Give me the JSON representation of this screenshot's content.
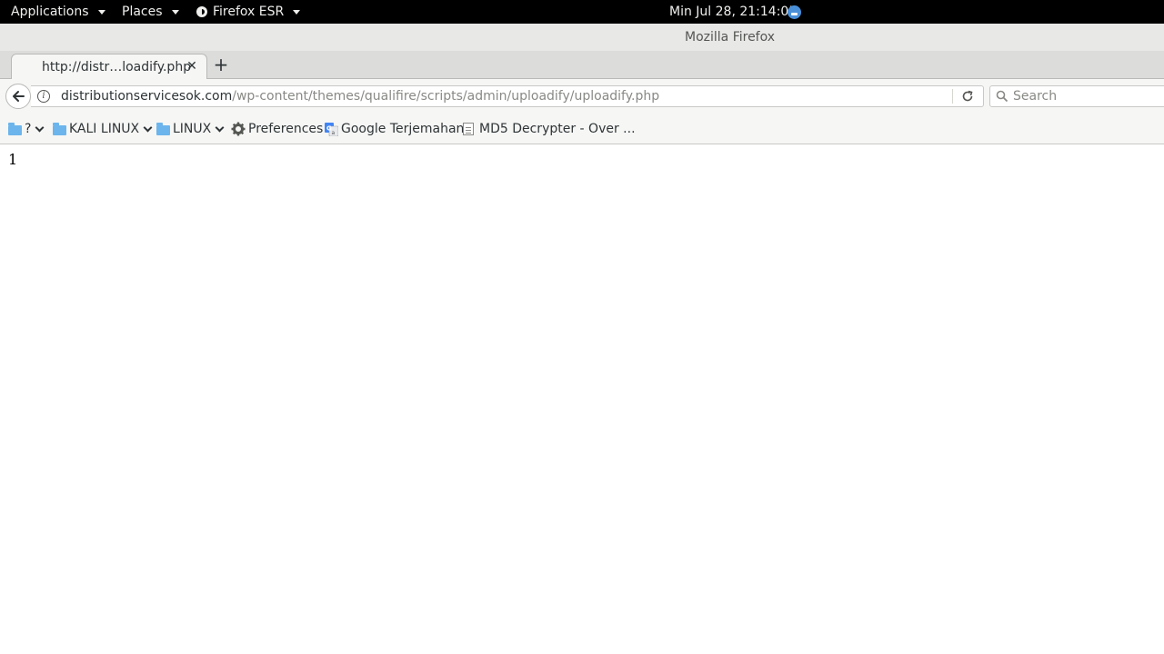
{
  "topbar": {
    "applications": "Applications",
    "places": "Places",
    "app_name": "Firefox ESR",
    "clock": "Min Jul 28, 21:14:05"
  },
  "window": {
    "title": "Mozilla Firefox"
  },
  "tabs": [
    {
      "label": "http://distr…loadify.php",
      "active": true
    }
  ],
  "navbar": {
    "url_domain": "distributionservicesok.com",
    "url_path": "/wp-content/themes/qualifire/scripts/admin/uploadify/uploadify.php",
    "search_placeholder": "Search"
  },
  "bookmarks": [
    {
      "label": "?",
      "icon": "folder-icon",
      "has_menu": true
    },
    {
      "label": "KALI LINUX",
      "icon": "folder-icon",
      "has_menu": true
    },
    {
      "label": "LINUX",
      "icon": "folder-icon",
      "has_menu": true
    },
    {
      "label": "Preferences",
      "icon": "gear-icon"
    },
    {
      "label": "Google Terjemahan",
      "icon": "google-translate-icon"
    },
    {
      "label": "MD5 Decrypter - Over ...",
      "icon": "page-icon"
    }
  ],
  "content": {
    "text": "1"
  },
  "colors": {
    "topbar_bg": "#000000",
    "folder": "#6cb5ec",
    "notification": "#4a90d9"
  }
}
